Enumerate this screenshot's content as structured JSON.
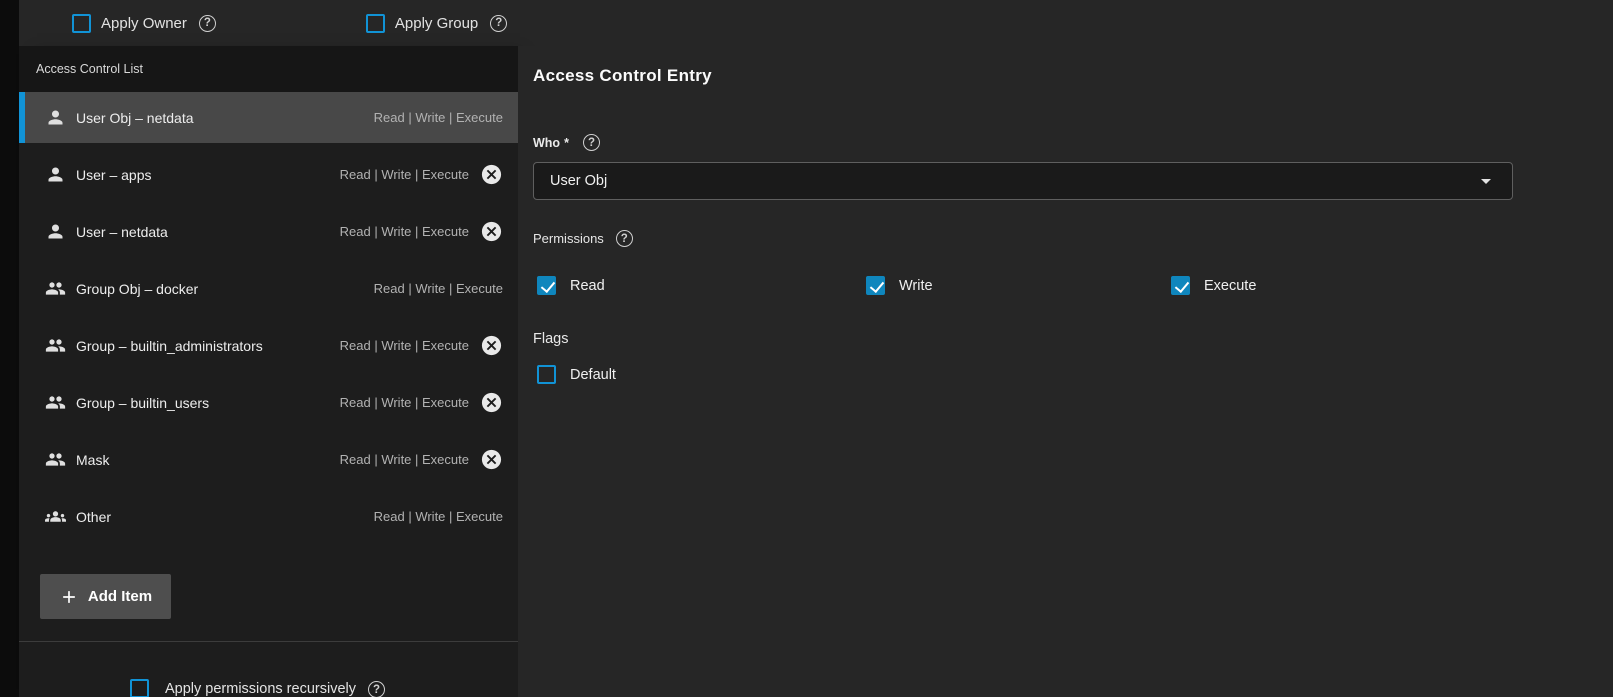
{
  "colors": {
    "accent": "#1193d6",
    "checkbox_fill": "#0f86bd",
    "selected_row_bg": "#484848",
    "left_panel_bg": "#1d1d1d",
    "right_panel_bg": "#262626"
  },
  "top_bar": {
    "apply_owner": {
      "label": "Apply Owner",
      "checked": false
    },
    "apply_group": {
      "label": "Apply Group",
      "checked": false
    }
  },
  "acl_list": {
    "title": "Access Control List",
    "items": [
      {
        "label": "User Obj – netdata",
        "permissions": "Read | Write | Execute",
        "icon": "person",
        "removable": false,
        "selected": true
      },
      {
        "label": "User – apps",
        "permissions": "Read | Write | Execute",
        "icon": "person",
        "removable": true,
        "selected": false
      },
      {
        "label": "User – netdata",
        "permissions": "Read | Write | Execute",
        "icon": "person",
        "removable": true,
        "selected": false
      },
      {
        "label": "Group Obj – docker",
        "permissions": "Read | Write | Execute",
        "icon": "people",
        "removable": false,
        "selected": false
      },
      {
        "label": "Group – builtin_administrators",
        "permissions": "Read | Write | Execute",
        "icon": "people",
        "removable": true,
        "selected": false
      },
      {
        "label": "Group – builtin_users",
        "permissions": "Read | Write | Execute",
        "icon": "people",
        "removable": true,
        "selected": false
      },
      {
        "label": "Mask",
        "permissions": "Read | Write | Execute",
        "icon": "people",
        "removable": true,
        "selected": false
      },
      {
        "label": "Other",
        "permissions": "Read | Write | Execute",
        "icon": "groups",
        "removable": false,
        "selected": false
      }
    ],
    "add_item_label": "Add Item",
    "recursive": {
      "label": "Apply permissions recursively",
      "checked": false
    }
  },
  "editor": {
    "title": "Access Control Entry",
    "who": {
      "label": "Who",
      "required_marker": "*",
      "value": "User Obj"
    },
    "permissions": {
      "label": "Permissions",
      "options": [
        {
          "label": "Read",
          "checked": true
        },
        {
          "label": "Write",
          "checked": true
        },
        {
          "label": "Execute",
          "checked": true
        }
      ]
    },
    "flags": {
      "label": "Flags",
      "options": [
        {
          "label": "Default",
          "checked": false
        }
      ]
    }
  }
}
